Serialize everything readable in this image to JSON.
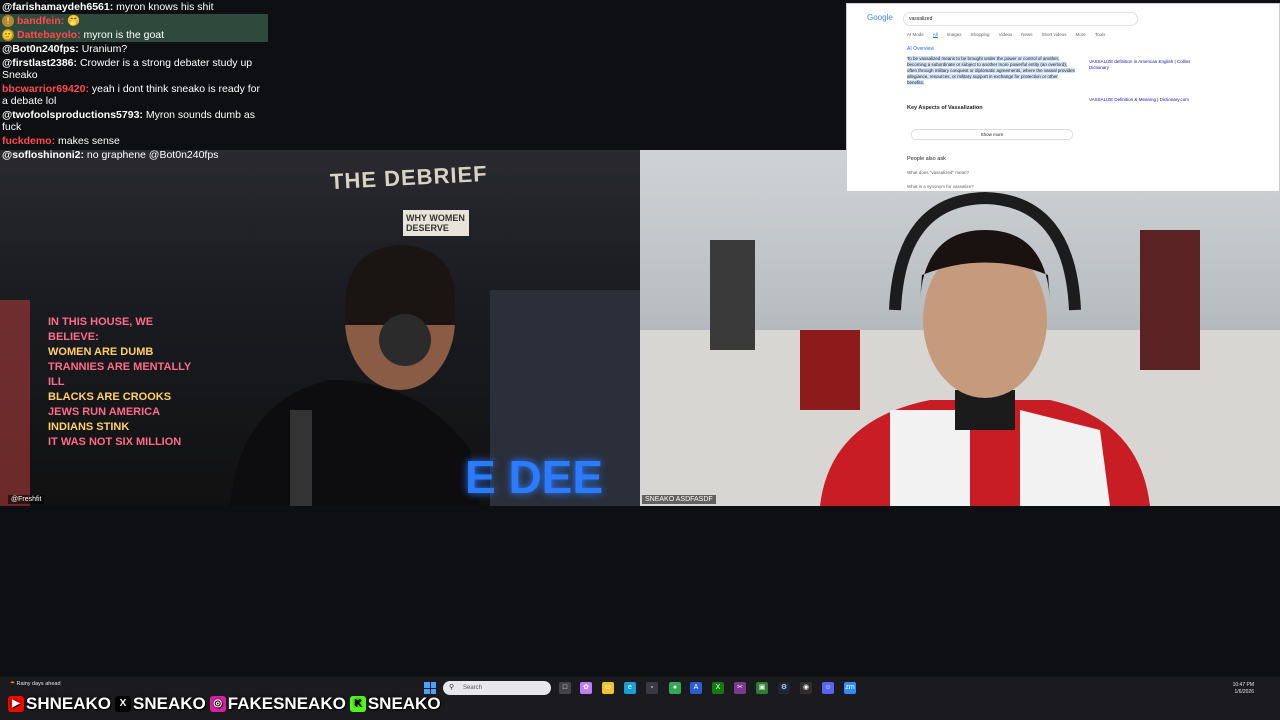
{
  "chat": [
    {
      "user": "@farishamaydeh6561:",
      "user_color": "#ffffff",
      "text": "myron knows his shit"
    },
    {
      "user": "bandfein:",
      "user_color": "#ff4b4b",
      "text": "🤭",
      "badge": "!",
      "highlight": true
    },
    {
      "user": "Dattebayolo:",
      "user_color": "#ff4b4b",
      "text": "myron is the goat",
      "badge": "🙂",
      "highlight": true
    },
    {
      "user": "@Bot0n240fps:",
      "user_color": "#ffffff",
      "text": "Uranium?"
    },
    {
      "user": "@firstlast2386:",
      "user_color": "#ffffff",
      "text": "Crowder is a strong debater study up Sneako"
    },
    {
      "user": "bbcwarrior69420:",
      "user_color": "#ff4b4b",
      "text": "yeah i dont think sneako is ready for a debate lol"
    },
    {
      "user": "@twofoolsproductions5793:",
      "user_color": "#ffffff",
      "text": "Myron sounds dumb as fuck"
    },
    {
      "user": "fuckdemo:",
      "user_color": "#ff4b4b",
      "text": "makes sense"
    },
    {
      "user": "@sofloshinoni2:",
      "user_color": "#ffffff",
      "text": "no graphene @Bot0n240fps"
    }
  ],
  "left_video": {
    "sign": "THE DEBRIEF",
    "neon_lines": [
      "IN THIS HOUSE, WE BELIEVE:",
      "WOMEN ARE DUMB",
      "TRANNIES ARE MENTALLY ILL",
      "BLACKS ARE CROOKS",
      "JEWS RUN AMERICA",
      "INDIANS STINK",
      "IT WAS NOT SIX MILLION"
    ],
    "book": "WHY WOMEN DESERVE",
    "neon_bottom": "E DEE",
    "nameplate": "@Freshfit"
  },
  "right_video": {
    "nameplate": "SNEAKO ASDFASDF"
  },
  "google": {
    "logo": "Google",
    "query": "vassalized",
    "tabs": [
      "AI Mode",
      "All",
      "Images",
      "Shopping",
      "Videos",
      "News",
      "Short videos",
      "More",
      "Tools"
    ],
    "overview_label": "AI Overview",
    "overview_text": "To be vassalized means to be brought under the power or control of another, becoming a subordinate or subject to another more powerful entity (an overlord), often through military conquest or diplomatic agreements, where the vassal provides allegiance, resources, or military support in exchange for protection or other benefits.",
    "key_aspects": "Key Aspects of Vassalization",
    "show_more": "Show more",
    "people_also_ask": "People also ask",
    "q1": "What does \"vassalized\" mean?",
    "q2": "What is a synonym for vassalize?",
    "side1": "VASSALIZE definition in American English | Collins Dictionary",
    "side2": "VASSALIZE Definition & Meaning | Dictionary.com"
  },
  "taskbar": {
    "weather": "Rainy days ahead",
    "search_placeholder": "Search",
    "time": "10:47 PM",
    "date": "1/6/2026"
  },
  "socials": [
    {
      "icon": "youtube-icon",
      "label": "SHNEAKO",
      "color": "#ff0000"
    },
    {
      "icon": "x-icon",
      "label": "SNEAKO",
      "color": "#000000"
    },
    {
      "icon": "instagram-icon",
      "label": "FAKESNEAKO",
      "color": "#d6249f"
    },
    {
      "icon": "kick-icon",
      "label": "SNEAKO",
      "color": "#53fc18"
    }
  ]
}
